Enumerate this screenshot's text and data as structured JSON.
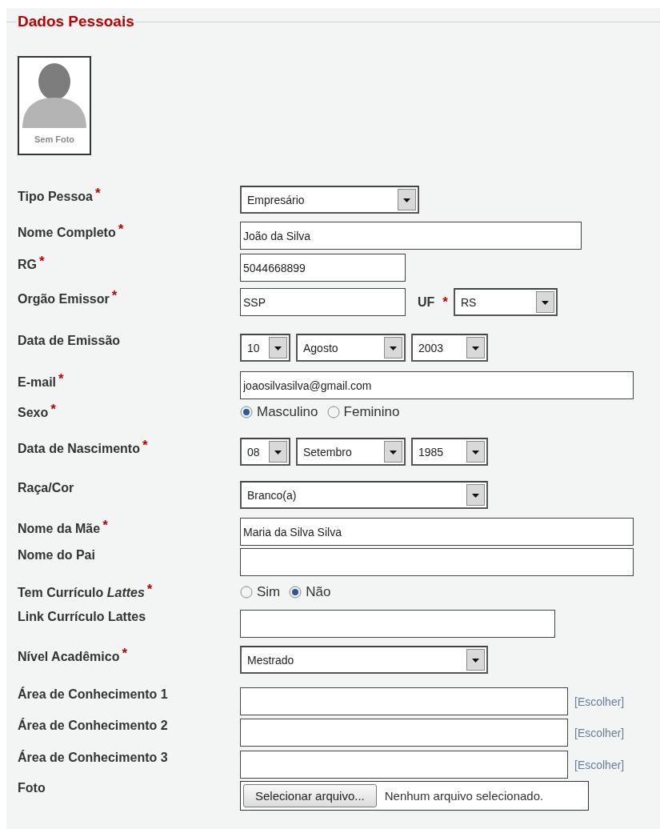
{
  "section": {
    "title": "Dados Pessoais"
  },
  "photo": {
    "caption": "Sem Foto"
  },
  "rows": [
    {
      "kind": "select",
      "label": "Tipo Pessoa",
      "mark": "*",
      "value": "Empresário"
    },
    {
      "kind": "text",
      "label": "Nome Completo",
      "mark": "*",
      "value": "João da Silva"
    },
    {
      "kind": "text",
      "label": "RG",
      "mark": "*",
      "value": "5044668899"
    },
    {
      "kind": "text_uf",
      "label": "Orgão Emissor",
      "mark": "*",
      "value": "SSP",
      "extra": {
        "label": "UF",
        "mark": "*",
        "value": "RS"
      }
    },
    {
      "kind": "date",
      "label": "Data de Emissão",
      "parts": [
        "10",
        "Agosto",
        "2003"
      ]
    },
    {
      "kind": "text",
      "label": "E-mail",
      "mark": "*",
      "value": "joaosilvasilva@gmail.com"
    },
    {
      "kind": "radio",
      "label": "Sexo",
      "mark": "*",
      "options": [
        {
          "label": "Masculino",
          "selected": true
        },
        {
          "label": "Feminino",
          "selected": false
        }
      ]
    },
    {
      "kind": "date",
      "label": "Data de Nascimento",
      "mark": "*",
      "parts": [
        "08",
        "Setembro",
        "1985"
      ]
    },
    {
      "kind": "select",
      "label": "Raça/Cor",
      "value": "Branco(a)"
    },
    {
      "kind": "text",
      "label": "Nome da Mãe",
      "mark": "*",
      "value": "Maria da Silva Silva"
    },
    {
      "kind": "text",
      "label": "Nome do Pai"
    },
    {
      "kind": "radio",
      "label": "Tem Currículo *Lattes*",
      "mark": "*",
      "options": [
        {
          "label": "Sim",
          "selected": false
        },
        {
          "label": "Não",
          "selected": true
        }
      ]
    },
    {
      "kind": "text",
      "label": "Link Currículo Lattes"
    },
    {
      "kind": "select",
      "label": "Nível Acadêmico",
      "mark": "*",
      "value": "Mestrado"
    },
    {
      "kind": "text_link",
      "label": "Área de Conhecimento 1",
      "link": "[Escolher]"
    },
    {
      "kind": "text_link",
      "label": "Área de Conhecimento 2",
      "link": "[Escolher]"
    },
    {
      "kind": "text_link",
      "label": "Área de Conhecimento 3",
      "link": "[Escolher]"
    },
    {
      "kind": "file",
      "label": "Foto",
      "button": "Selecionar arquivo...",
      "status": "Nenhum arquivo selecionado."
    }
  ]
}
